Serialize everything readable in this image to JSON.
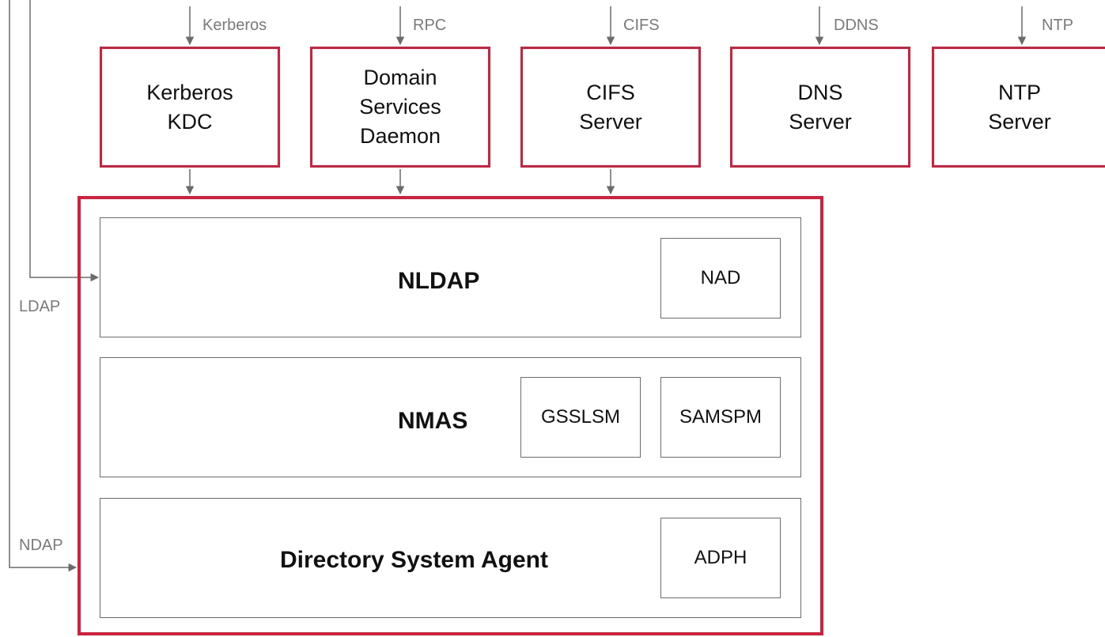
{
  "protocols": {
    "kerberos": "Kerberos",
    "rpc": "RPC",
    "cifs": "CIFS",
    "ddns": "DDNS",
    "ntp": "NTP",
    "ldap": "LDAP",
    "ndap": "NDAP"
  },
  "servers": {
    "kdc": [
      "Kerberos",
      "KDC"
    ],
    "domain_services": [
      "Domain",
      "Services",
      "Daemon"
    ],
    "cifs": [
      "CIFS",
      "Server"
    ],
    "dns": [
      "DNS",
      "Server"
    ],
    "ntp": [
      "NTP",
      "Server"
    ]
  },
  "layers": {
    "nldap": {
      "title": "NLDAP",
      "modules": [
        "NAD"
      ]
    },
    "nmas": {
      "title": "NMAS",
      "modules": [
        "GSSLSM",
        "SAMSPM"
      ]
    },
    "dsa": {
      "title": "Directory System Agent",
      "modules": [
        "ADPH"
      ]
    }
  },
  "colors": {
    "accent_border": "#d41e3c",
    "connector": "#6b6b6b",
    "protocol_text": "#7a7a7a"
  }
}
